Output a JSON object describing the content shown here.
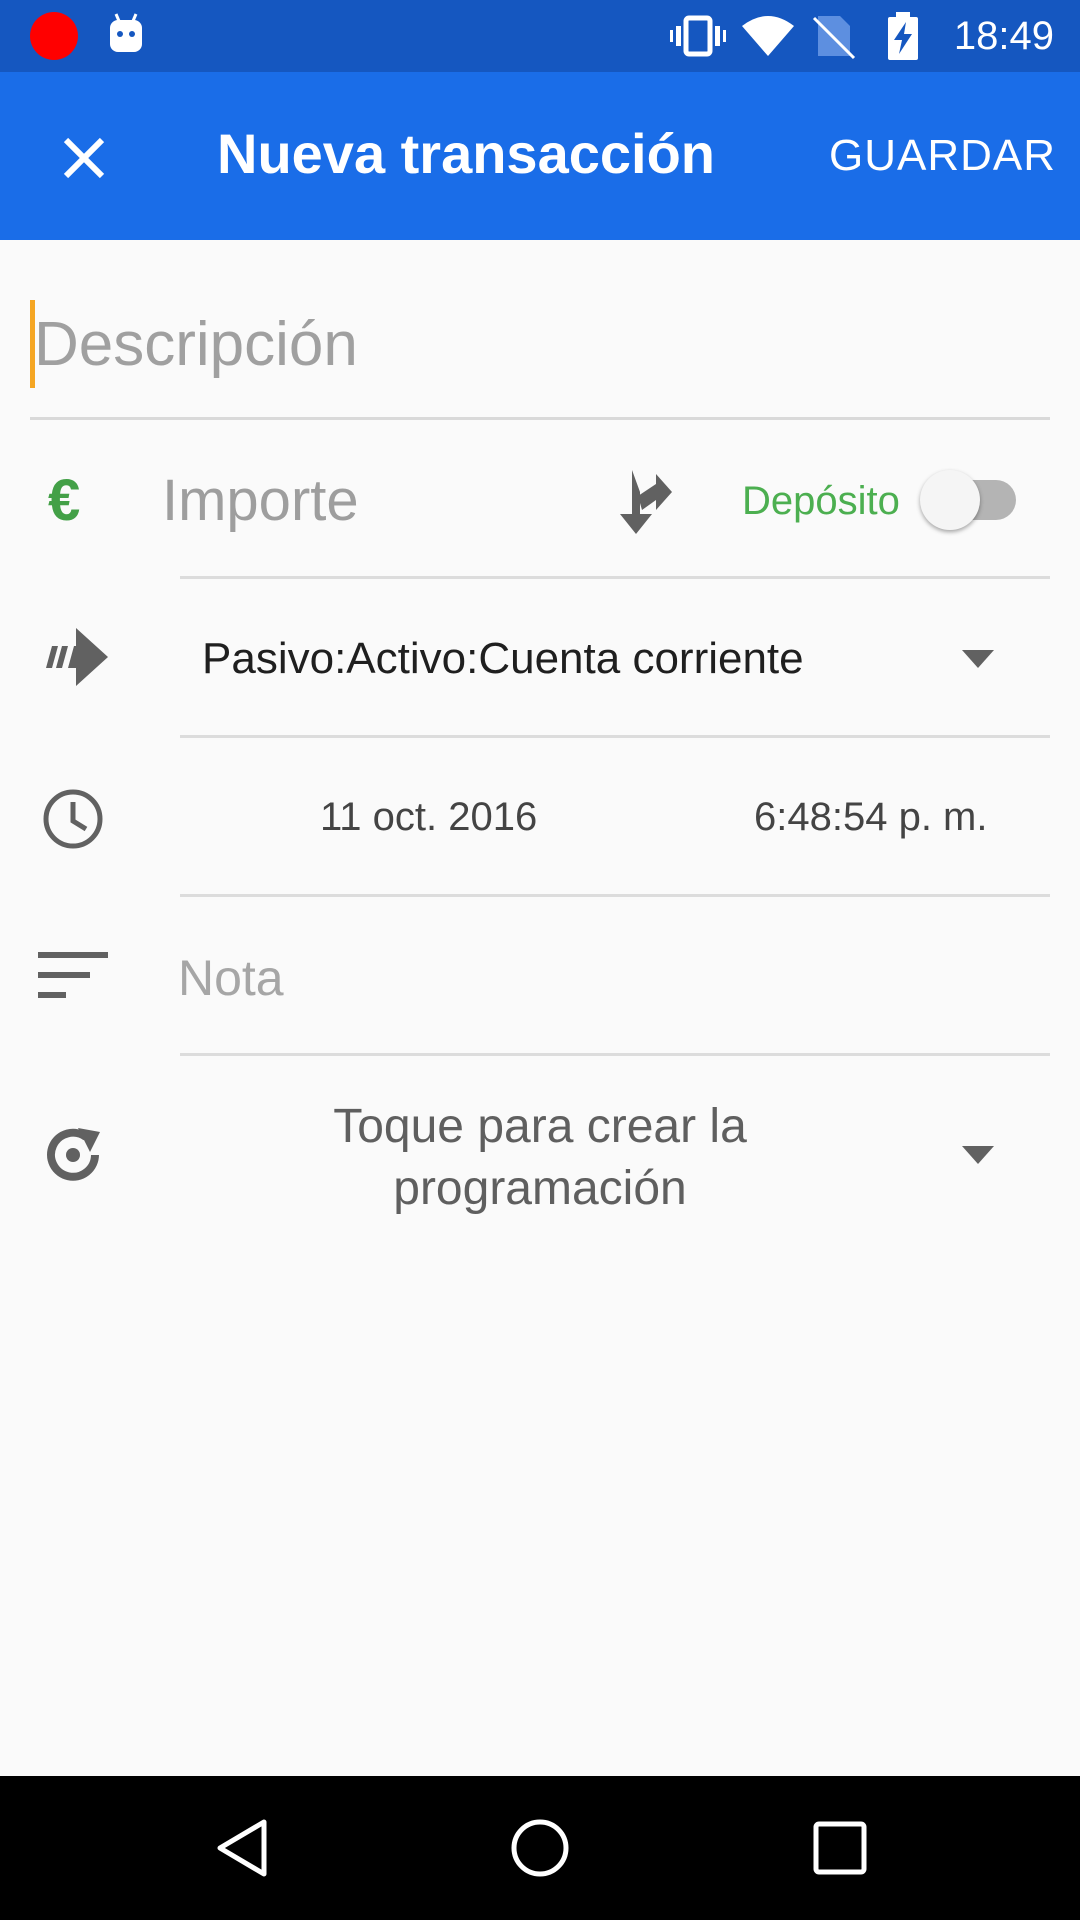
{
  "status_bar": {
    "time": "18:49",
    "icons": [
      "record-indicator",
      "android-debug-icon",
      "vibrate-icon",
      "wifi-icon",
      "no-sim-icon",
      "battery-charging-icon"
    ]
  },
  "app_bar": {
    "close_icon": "close-icon",
    "title": "Nueva transacción",
    "save_label": "GUARDAR"
  },
  "form": {
    "description": {
      "placeholder": "Descripción",
      "value": ""
    },
    "amount": {
      "currency_symbol": "€",
      "placeholder": "Importe",
      "split_icon": "split-icon",
      "type_label": "Depósito",
      "deposit_toggle_on": false
    },
    "account": {
      "value": "Pasivo:Activo:Cuenta corriente"
    },
    "datetime": {
      "date": "11 oct. 2016",
      "time": "6:48:54 p. m."
    },
    "note": {
      "placeholder": "Nota"
    },
    "schedule": {
      "label": "Toque para crear la programación"
    }
  },
  "colors": {
    "status_bar": "#1557c0",
    "app_bar": "#1a6de8",
    "deposit_green": "#4caf50",
    "caret": "#f5a623"
  },
  "nav_bar": {
    "buttons": [
      "back-icon",
      "home-icon",
      "recents-icon"
    ]
  }
}
